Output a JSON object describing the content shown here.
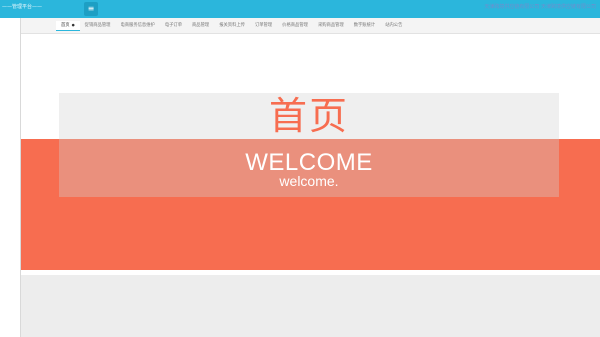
{
  "header": {
    "app_title": "——管理平台——",
    "menu_icon": "hamburger-icon",
    "info_text": "天津跨境供应链有限公司 天津跨境供应链有限公司"
  },
  "tabs": [
    {
      "label": "首页",
      "active": true,
      "close": "●"
    },
    {
      "label": "促销商品管理"
    },
    {
      "label": "电商服务信息维护"
    },
    {
      "label": "电子订单"
    },
    {
      "label": "商品管理"
    },
    {
      "label": "报关资料上传"
    },
    {
      "label": "订单管理"
    },
    {
      "label": "价格商品管理"
    },
    {
      "label": "采购商品管理"
    },
    {
      "label": "数字账统计"
    },
    {
      "label": "站内公告"
    }
  ],
  "main": {
    "home_title": "首页",
    "welcome_upper": "WELCOME",
    "welcome_lower": "welcome."
  },
  "colors": {
    "header": "#2bb6dc",
    "banner": "#f76d50",
    "gray_box": "#d2d2d2"
  }
}
